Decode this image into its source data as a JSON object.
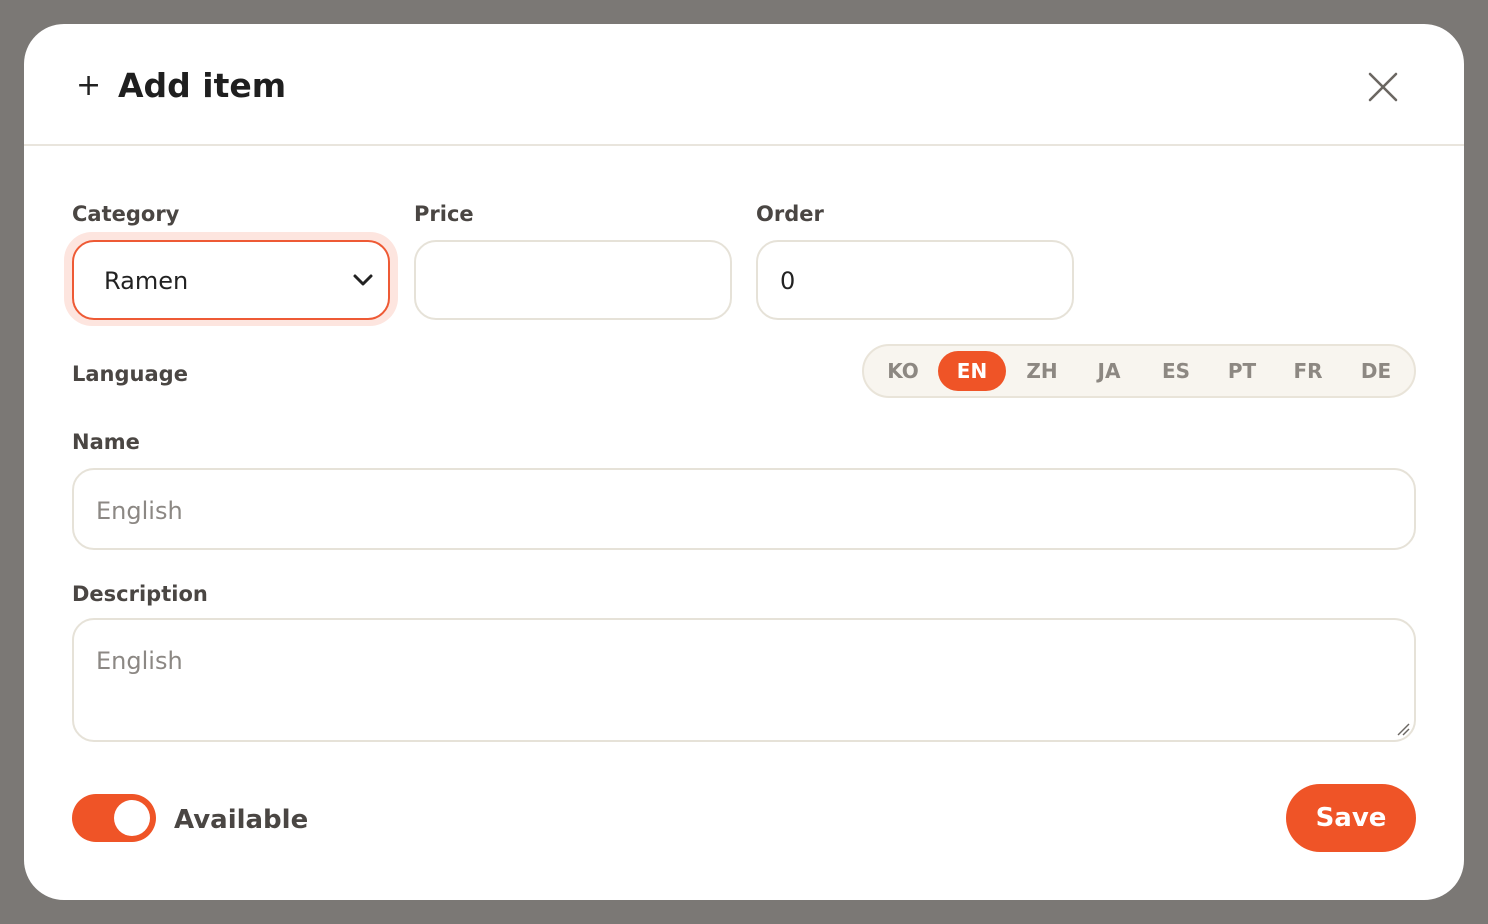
{
  "modal": {
    "title_icon": "plus-icon",
    "title_icon_glyph": "+",
    "title": "Add item",
    "close_icon": "close-icon"
  },
  "form": {
    "category": {
      "label": "Category",
      "selected": "Ramen"
    },
    "price": {
      "label": "Price",
      "value": ""
    },
    "order": {
      "label": "Order",
      "value": "0"
    },
    "language": {
      "label": "Language",
      "options": [
        "KO",
        "EN",
        "ZH",
        "JA",
        "ES",
        "PT",
        "FR",
        "DE"
      ],
      "selected": "EN"
    },
    "name": {
      "label": "Name",
      "placeholder": "English"
    },
    "description": {
      "label": "Description",
      "placeholder": "English"
    },
    "available": {
      "label": "Available",
      "on": true
    },
    "save_label": "Save"
  },
  "colors": {
    "accent": "#ef5427",
    "focus_ring": "#fde5df",
    "border": "#e6e2d8",
    "backdrop": "#7b7875"
  }
}
